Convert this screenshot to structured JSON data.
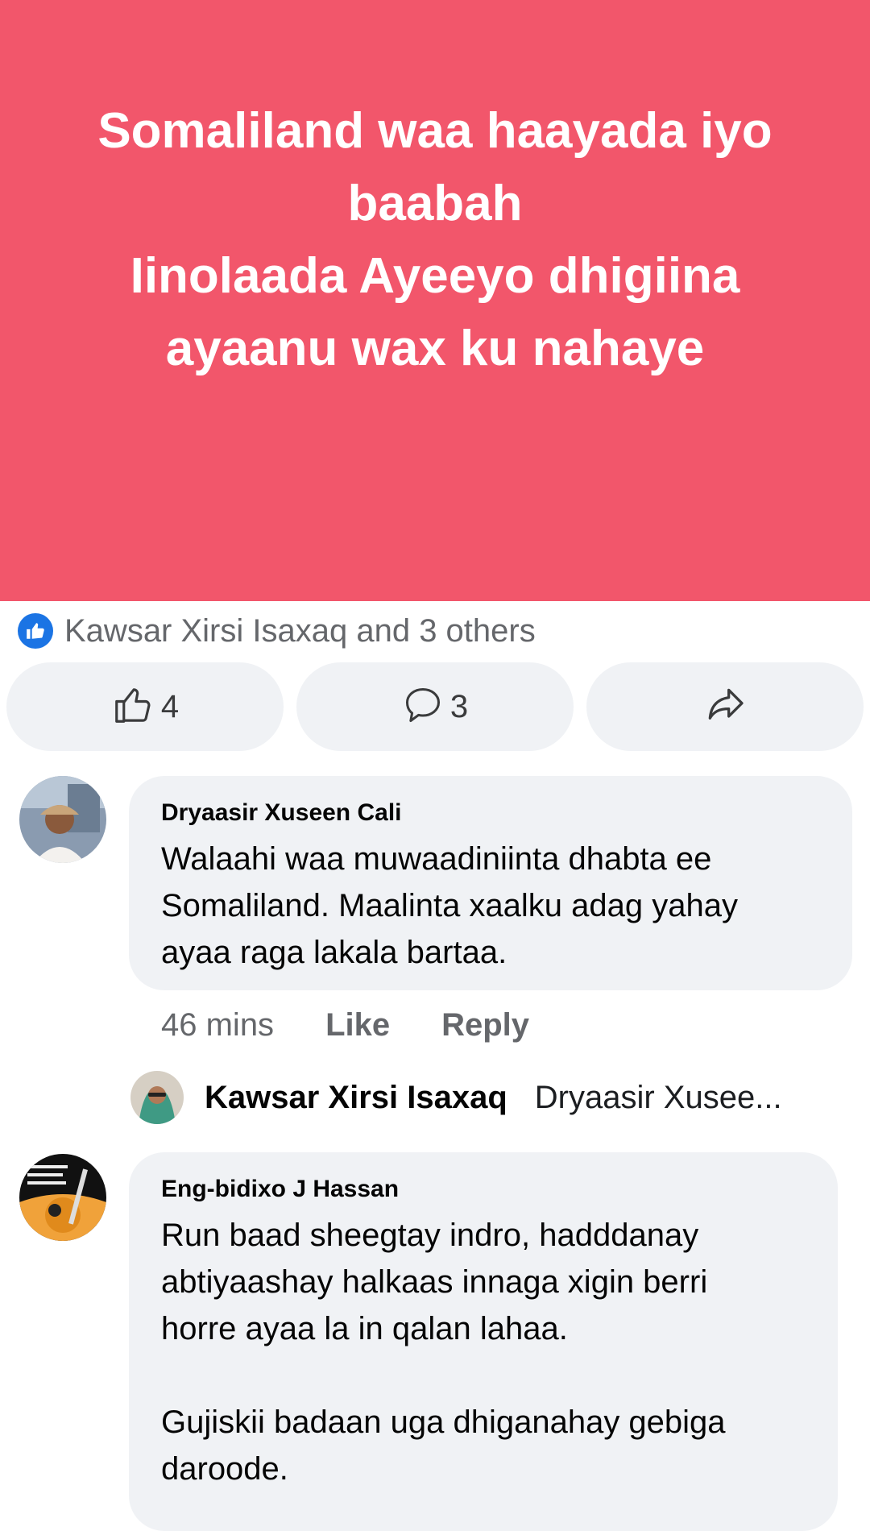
{
  "post": {
    "text": "Somaliland  waa haayada iyo\nbaabah\nIinolaada Ayeeyo  dhigiina\nayaanu wax ku nahaye",
    "background_color": "#f2566b"
  },
  "reactions": {
    "summary": "Kawsar Xirsi Isaxaq and 3 others",
    "like_badge_icon": "thumbs-up-icon"
  },
  "actions": {
    "like": {
      "icon": "thumbs-up-outline-icon",
      "count": "4"
    },
    "comment": {
      "icon": "speech-bubble-icon",
      "count": "3"
    },
    "share": {
      "icon": "share-arrow-icon"
    }
  },
  "comments": [
    {
      "author": "Dryaasir Xuseen Cali",
      "text": "Walaahi waa muwaadiniinta dhabta ee\nSomaliland. Maalinta xaalku adag yahay\nayaa raga lakala bartaa.",
      "time": "46 mins",
      "like_label": "Like",
      "reply_label": "Reply",
      "reply_preview": {
        "author": "Kawsar Xirsi Isaxaq",
        "snippet": "Dryaasir Xusee..."
      }
    },
    {
      "author": "Eng-bidixo J Hassan",
      "text": "Run baad sheegtay indro, hadddanay\nabtiyaashay halkaas innaga xigin berri\nhorre ayaa la  in qalan lahaa.\n\nGujiskii badaan uga dhiganahay gebiga\ndaroode."
    }
  ]
}
